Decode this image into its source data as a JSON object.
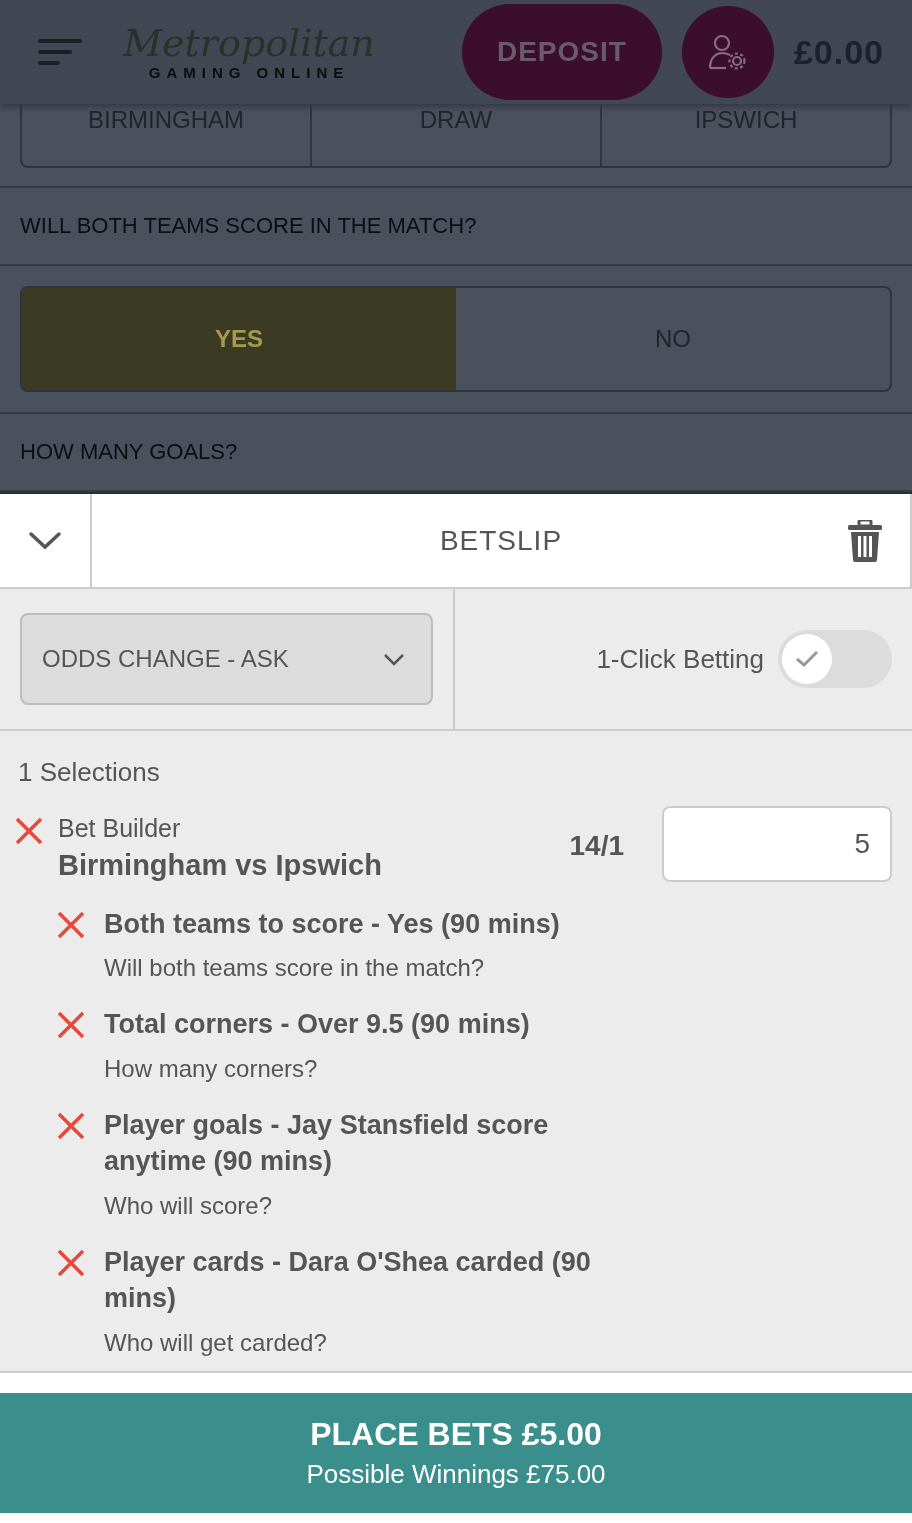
{
  "header": {
    "logo_title": "Metropolitan",
    "logo_subtitle": "GAMING ONLINE",
    "deposit_button": "DEPOSIT",
    "balance": "£0.00"
  },
  "match_outcome": [
    {
      "label": "BIRMINGHAM",
      "selected": false
    },
    {
      "label": "DRAW",
      "selected": false
    },
    {
      "label": "IPSWICH",
      "selected": false
    }
  ],
  "markets": [
    {
      "question": "WILL BOTH TEAMS SCORE IN THE MATCH?",
      "options": [
        {
          "label": "YES",
          "selected": true
        },
        {
          "label": "NO",
          "selected": false
        }
      ]
    },
    {
      "question": "HOW MANY GOALS?"
    }
  ],
  "betslip": {
    "title": "BETSLIP",
    "odds_change": "ODDS CHANGE - ASK",
    "one_click": {
      "label": "1-Click Betting",
      "on": false
    },
    "selection_count": "1 Selections",
    "bet": {
      "type": "Bet Builder",
      "event": "Birmingham vs Ipswich",
      "odds": "14/1",
      "stake": "5",
      "legs": [
        {
          "title": "Both teams to score - Yes (90 mins)",
          "question": "Will both teams score in the match?"
        },
        {
          "title": "Total corners - Over 9.5 (90 mins)",
          "question": "How many corners?"
        },
        {
          "title": "Player goals - Jay Stansfield score anytime (90 mins)",
          "question": "Who will score?"
        },
        {
          "title": "Player cards - Dara O'Shea carded (90 mins)",
          "question": "Who will get carded?"
        }
      ]
    },
    "place_button": {
      "label": "PLACE BETS £5.00",
      "winnings": "Possible Winnings £75.00"
    }
  }
}
